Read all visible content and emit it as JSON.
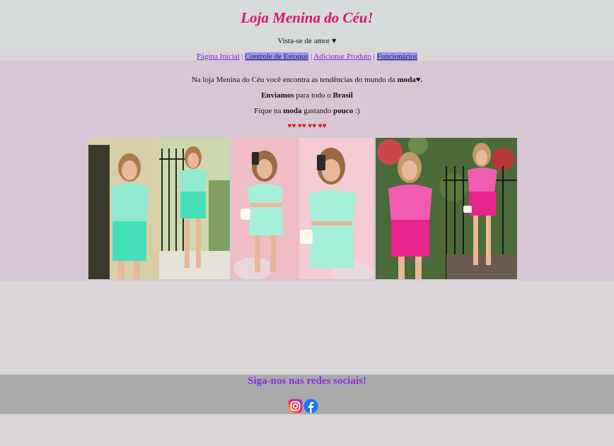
{
  "header": {
    "title": "Loja Menina do Céu!",
    "tagline": "Vista-se de amor ♥"
  },
  "nav": {
    "items": [
      {
        "label": "Página Inicial"
      },
      {
        "label": "Controle de Estoque"
      },
      {
        "label": "Adicionar Produto"
      },
      {
        "label": "Funcionários"
      }
    ],
    "separator": "|"
  },
  "main": {
    "intro_pre": "Na loja Menina do Céu você encontra as tendências do mundo da ",
    "intro_bold": "moda♥.",
    "shipping_bold": "Enviamos",
    "shipping_rest": " para todo o ",
    "shipping_country": "Brasil",
    "slogan_pre": "Fique na ",
    "slogan_bold1": "moda",
    "slogan_mid": " gastando ",
    "slogan_bold2": "pouco",
    "slogan_post": " :)",
    "hearts": "♥♥ ♥♥ ♥♥ ♥♥",
    "photos": [
      {
        "icon": "outfit-photo-mint-lace",
        "outfit_color": "#5fe0c0"
      },
      {
        "icon": "outfit-photo-mint-crop",
        "outfit_color": "#8fe8cf"
      },
      {
        "icon": "outfit-photo-pink-set",
        "outfit_color": "#e8238c"
      }
    ]
  },
  "footer": {
    "title": "Siga-nos nas redes sociais!",
    "socials": [
      {
        "icon": "instagram-icon"
      },
      {
        "icon": "facebook-icon"
      }
    ]
  },
  "colors": {
    "title": "#d4146e",
    "accent": "#8a2be2",
    "hearts": "#e0141e",
    "main_bg": "#d7c6d3",
    "footer_bg": "#aaaaaa"
  }
}
